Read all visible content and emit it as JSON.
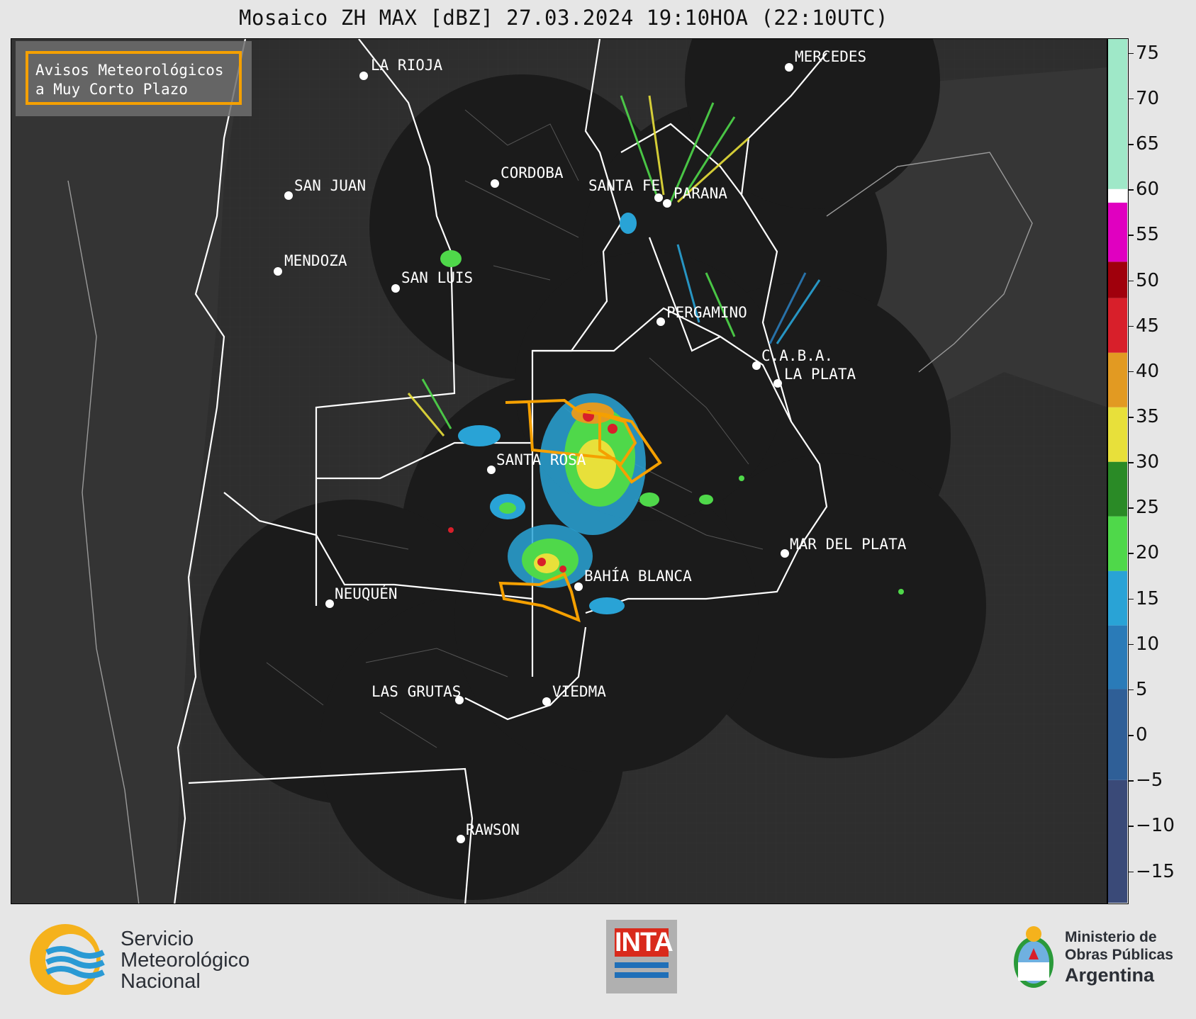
{
  "title": "Mosaico ZH MAX [dBZ] 27.03.2024 19:10HOA (22:10UTC)",
  "legend_box": {
    "line1": "Avisos Meteorológicos",
    "line2": "a Muy Corto Plazo",
    "border_color": "#f5a000"
  },
  "cities": [
    {
      "name": "LA RIOJA"
    },
    {
      "name": "MERCEDES"
    },
    {
      "name": "CORDOBA"
    },
    {
      "name": "SAN JUAN"
    },
    {
      "name": "SANTA FE"
    },
    {
      "name": "PARANA"
    },
    {
      "name": "MENDOZA"
    },
    {
      "name": "SAN LUIS"
    },
    {
      "name": "PERGAMINO"
    },
    {
      "name": "C.A.B.A."
    },
    {
      "name": "LA PLATA"
    },
    {
      "name": "SANTA ROSA"
    },
    {
      "name": "MAR DEL PLATA"
    },
    {
      "name": "BAHÍA BLANCA"
    },
    {
      "name": "NEUQUÉN"
    },
    {
      "name": "LAS GRUTAS"
    },
    {
      "name": "VIEDMA"
    },
    {
      "name": "RAWSON"
    }
  ],
  "colorbar": {
    "ticks": [
      75,
      70,
      65,
      60,
      55,
      50,
      45,
      40,
      35,
      30,
      25,
      20,
      15,
      10,
      5,
      0,
      -5,
      -10,
      -15
    ],
    "tick_labels": [
      "75",
      "70",
      "65",
      "60",
      "55",
      "50",
      "45",
      "40",
      "35",
      "30",
      "25",
      "20",
      "15",
      "10",
      "5",
      "0",
      "−5",
      "−10",
      "−15"
    ],
    "range": [
      -18.5,
      76.5
    ],
    "bands": [
      {
        "from": -18.5,
        "to": -5,
        "color": "#3a4a78"
      },
      {
        "from": -5,
        "to": 5,
        "color": "#2f5f97"
      },
      {
        "from": 5,
        "to": 12,
        "color": "#2a7bb8"
      },
      {
        "from": 12,
        "to": 18,
        "color": "#29a3d6"
      },
      {
        "from": 18,
        "to": 24,
        "color": "#4fd84a"
      },
      {
        "from": 24,
        "to": 30,
        "color": "#2a8a26"
      },
      {
        "from": 30,
        "to": 36,
        "color": "#e8e03a"
      },
      {
        "from": 36,
        "to": 42,
        "color": "#e29a22"
      },
      {
        "from": 42,
        "to": 48,
        "color": "#d81f2a"
      },
      {
        "from": 48,
        "to": 52,
        "color": "#a0000c"
      },
      {
        "from": 52,
        "to": 58.5,
        "color": "#e000c0"
      },
      {
        "from": 58.5,
        "to": 60,
        "color": "#ffffff"
      },
      {
        "from": 60,
        "to": 76.5,
        "color": "#9fe8c8"
      }
    ]
  },
  "footer": {
    "smn_line1": "Servicio",
    "smn_line2": "Meteorológico",
    "smn_line3": "Nacional",
    "inta": "INTA",
    "min_line1": "Ministerio de",
    "min_line2": "Obras Públicas",
    "min_line3": "Argentina"
  }
}
